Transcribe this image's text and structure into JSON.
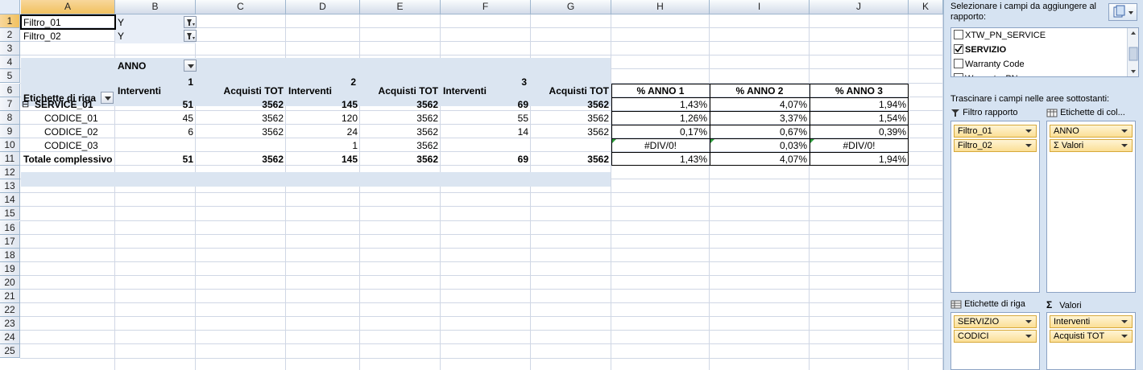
{
  "columns": [
    "A",
    "B",
    "C",
    "D",
    "E",
    "F",
    "G",
    "H",
    "I",
    "J",
    "K"
  ],
  "rows": [
    "1",
    "2",
    "3",
    "4",
    "5",
    "6",
    "7",
    "8",
    "9",
    "10",
    "11",
    "12",
    "13",
    "14",
    "15",
    "16",
    "17",
    "18",
    "19",
    "20",
    "21",
    "22",
    "23",
    "24",
    "25"
  ],
  "filters": [
    {
      "label": "Filtro_01",
      "value": "Y"
    },
    {
      "label": "Filtro_02",
      "value": "Y"
    }
  ],
  "pivot": {
    "col_field": "ANNO",
    "years": [
      "1",
      "2",
      "3"
    ],
    "row_labels_header": "Etichette di riga",
    "measure_headers": [
      "Interventi",
      "Acquisti TOT",
      "Interventi",
      "Acquisti TOT",
      "Interventi",
      "Acquisti TOT"
    ],
    "rows": [
      {
        "label": "SERVICE_01",
        "values": [
          "51",
          "3562",
          "145",
          "3562",
          "69",
          "3562"
        ]
      },
      {
        "label": "CODICE_01",
        "values": [
          "45",
          "3562",
          "120",
          "3562",
          "55",
          "3562"
        ]
      },
      {
        "label": "CODICE_02",
        "values": [
          "6",
          "3562",
          "24",
          "3562",
          "14",
          "3562"
        ]
      },
      {
        "label": "CODICE_03",
        "values": [
          "",
          "",
          "1",
          "3562",
          "",
          ""
        ]
      }
    ],
    "total": {
      "label": "Totale complessivo",
      "values": [
        "51",
        "3562",
        "145",
        "3562",
        "69",
        "3562"
      ]
    },
    "collapse_glyph": "⊟"
  },
  "pct_table": {
    "headers": [
      "% ANNO 1",
      "% ANNO 2",
      "% ANNO 3"
    ],
    "rows": [
      [
        "1,43%",
        "4,07%",
        "1,94%"
      ],
      [
        "1,26%",
        "3,37%",
        "1,54%"
      ],
      [
        "0,17%",
        "0,67%",
        "0,39%"
      ],
      [
        "#DIV/0!",
        "0,03%",
        "#DIV/0!"
      ],
      [
        "1,43%",
        "4,07%",
        "1,94%"
      ]
    ]
  },
  "panel": {
    "select_fields_label_1": "Selezionare i campi da aggiungere al",
    "select_fields_label_2": "rapporto:",
    "fields": [
      {
        "name": "XTW_PN_SERVICE",
        "checked": false
      },
      {
        "name": "SERVIZIO",
        "checked": true
      },
      {
        "name": "Warranty Code",
        "checked": false
      },
      {
        "name": "Warranty_PN",
        "checked": false
      }
    ],
    "drag_label": "Trascinare i campi nelle aree sottostanti:",
    "zones": {
      "report_filter": {
        "label": "Filtro rapporto",
        "items": [
          "Filtro_01",
          "Filtro_02"
        ]
      },
      "column_labels": {
        "label": "Etichette di col...",
        "items": [
          "ANNO",
          "Σ Valori"
        ]
      },
      "row_labels": {
        "label": "Etichette di riga",
        "items": [
          "SERVIZIO",
          "CODICI"
        ]
      },
      "values": {
        "label": "Valori",
        "items": [
          "Interventi",
          "Acquisti TOT"
        ]
      }
    },
    "sigma": "Σ"
  },
  "colors": {
    "pivot_band": "#dbe5f1",
    "header_blue": "#d3dbe9",
    "panel_bg": "#d6e3f2",
    "pill": "#fbdf96"
  }
}
